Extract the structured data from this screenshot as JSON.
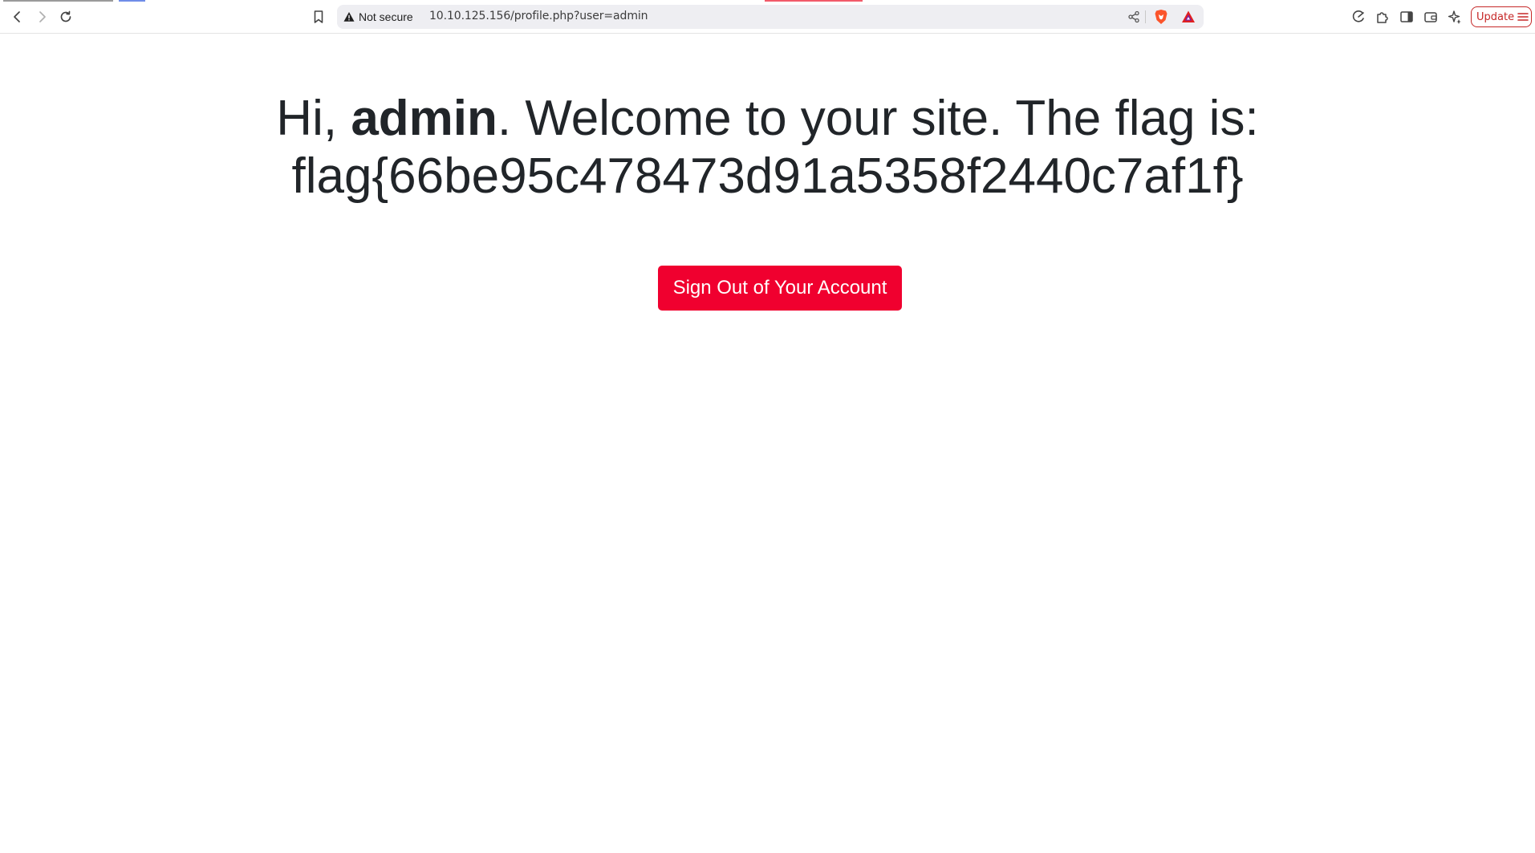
{
  "browser": {
    "security_label": "Not secure",
    "url": "10.10.125.156/profile.php?user=admin",
    "update_label": "Update",
    "colors": {
      "brave_orange": "#fb542b",
      "bat_red": "#e02020",
      "update_red": "#c62828"
    }
  },
  "page": {
    "greeting_prefix": "Hi,",
    "username": "admin",
    "greeting_suffix": ". Welcome to your site. The flag is:",
    "flag": "flag{66be95c478473d91a5358f2440c7af1f}",
    "signout_label": "Sign Out of Your Account",
    "button_color": "#f0002f"
  }
}
